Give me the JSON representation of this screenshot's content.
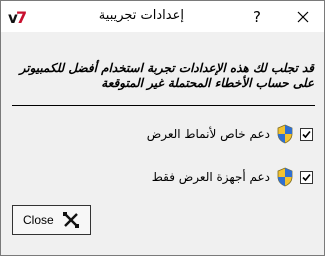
{
  "window": {
    "title": "إعدادات تجريبية",
    "help_label": "?",
    "app_logo_text": "V7"
  },
  "intro": {
    "text": "قد تجلب لك هذه الإعدادات تجربة استخدام أفضل للكمبيوتر على حساب الأخطاء المحتملة غير المتوقعة"
  },
  "options": [
    {
      "label": "دعم خاص لأنماط العرض",
      "checked": true,
      "icon": "uac-shield-icon"
    },
    {
      "label": "دعم أجهزة العرض فقط",
      "checked": true,
      "icon": "uac-shield-icon"
    }
  ],
  "buttons": {
    "close_label": "Close"
  }
}
